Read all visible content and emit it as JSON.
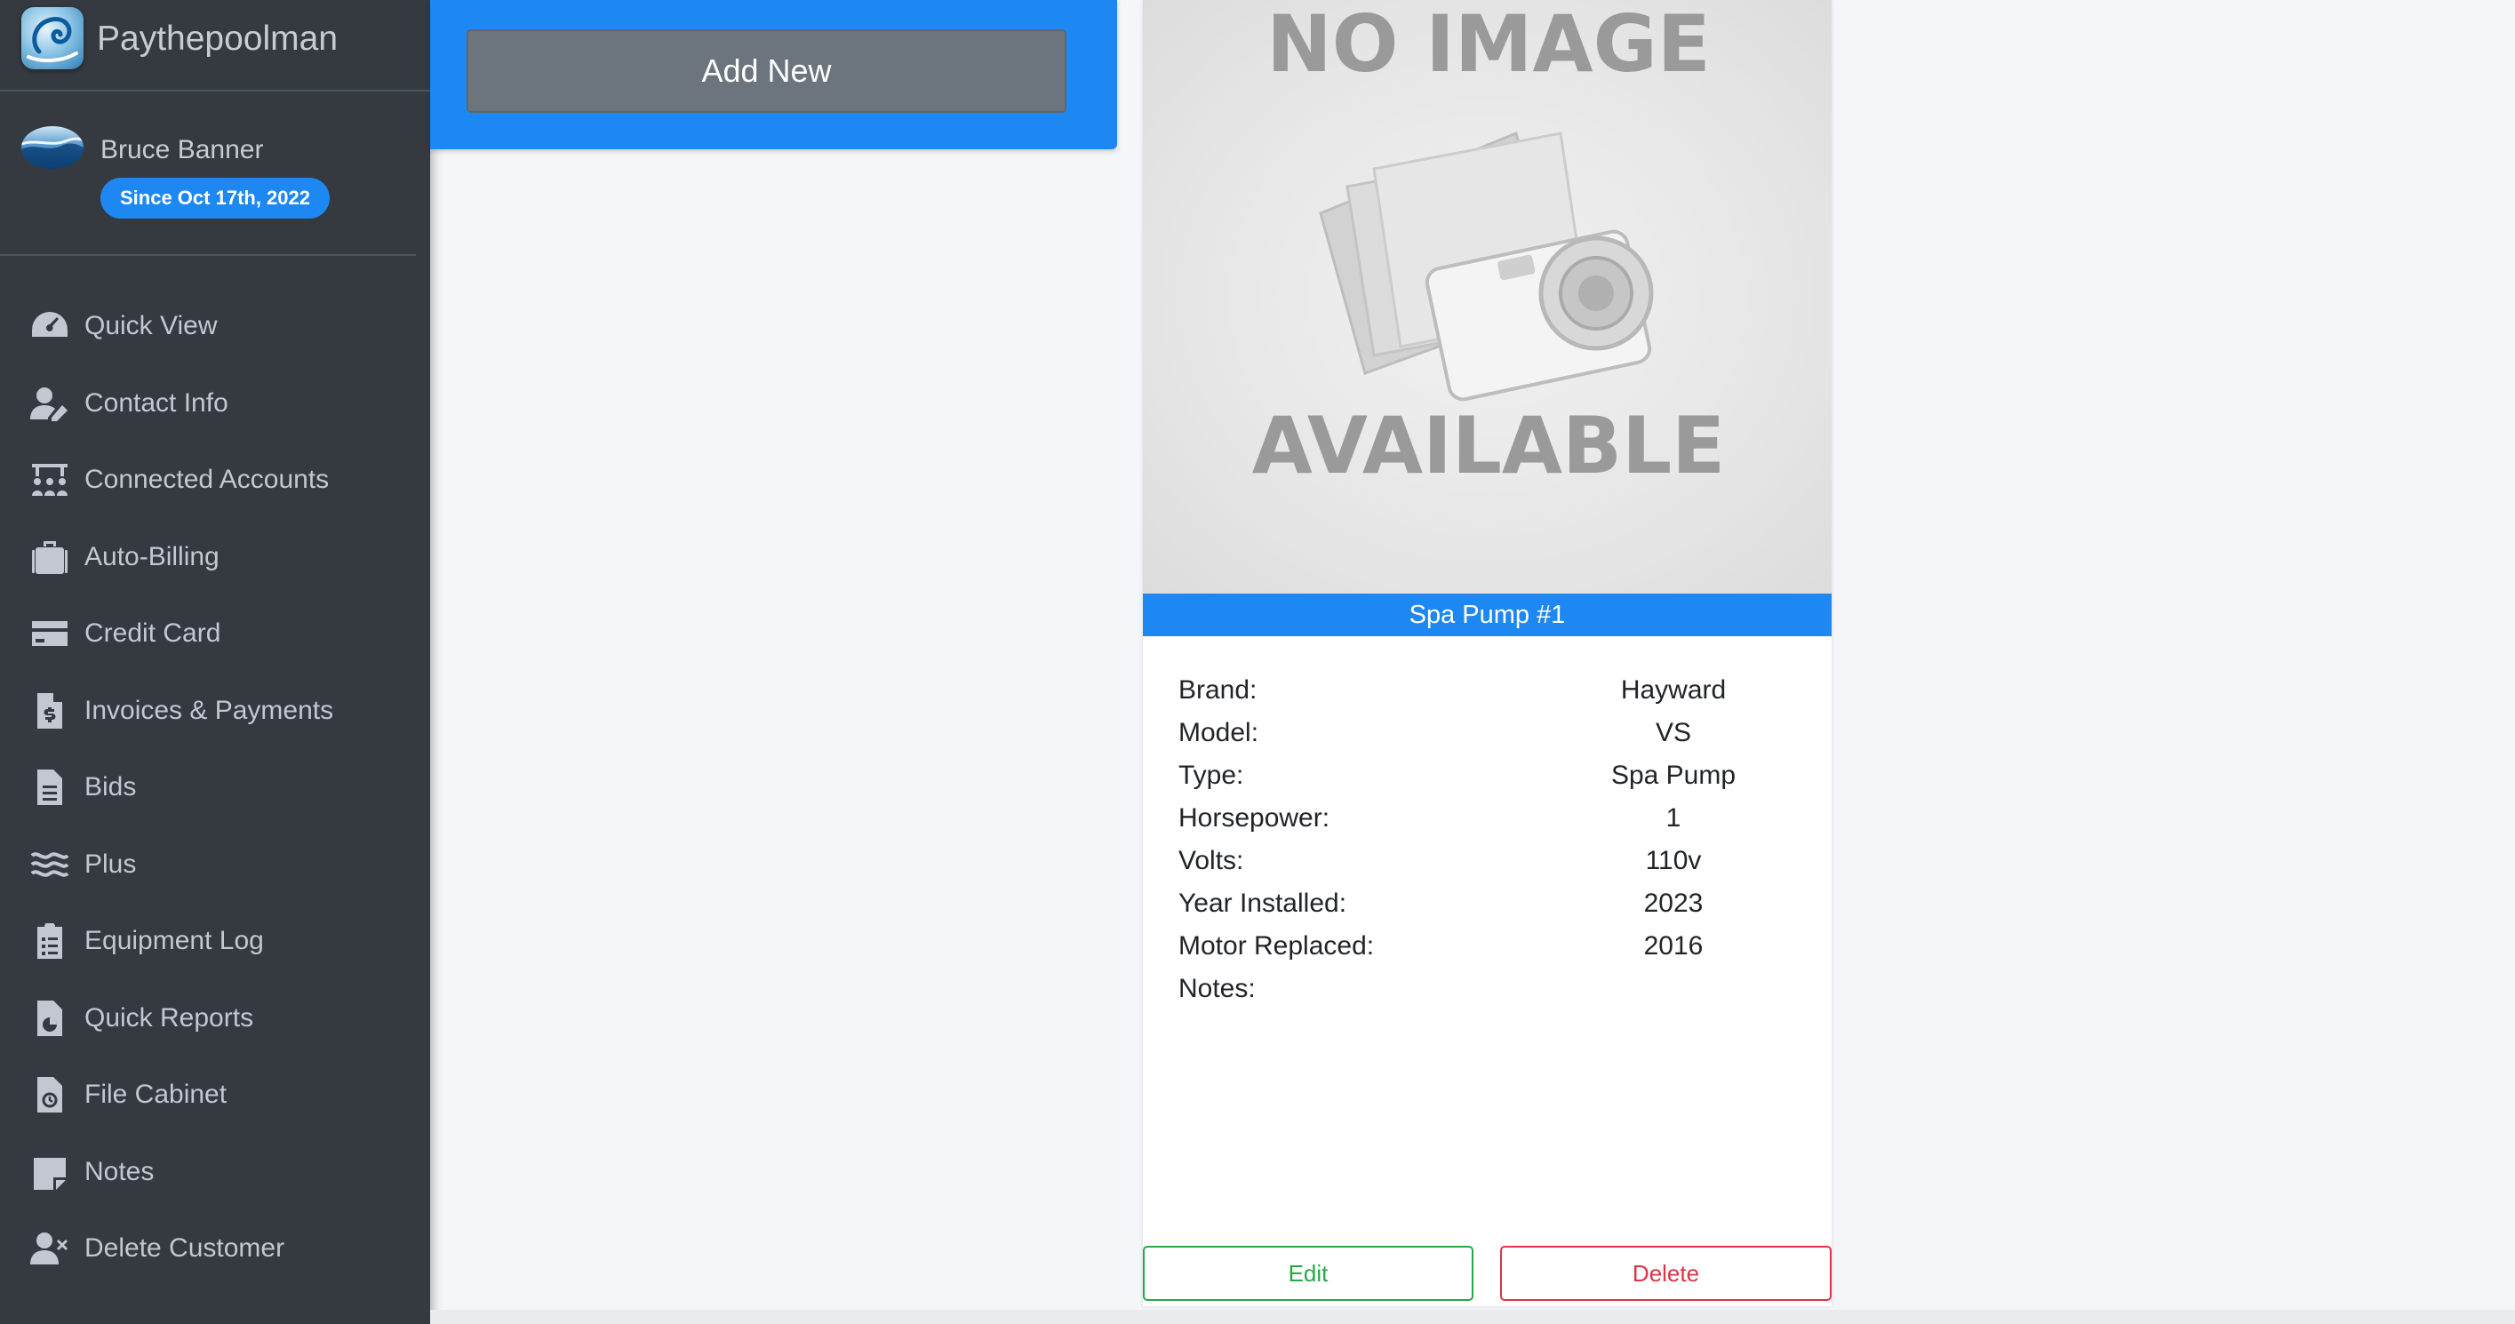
{
  "brand": {
    "name": "Paythepoolman"
  },
  "user": {
    "name": "Bruce Banner",
    "since": "Since Oct 17th, 2022"
  },
  "sidebar": {
    "items": [
      {
        "label": "Quick View",
        "icon": "gauge-icon"
      },
      {
        "label": "Contact Info",
        "icon": "user-edit-icon"
      },
      {
        "label": "Connected Accounts",
        "icon": "users-board-icon"
      },
      {
        "label": "Auto-Billing",
        "icon": "suitcase-icon"
      },
      {
        "label": "Credit Card",
        "icon": "credit-card-icon"
      },
      {
        "label": "Invoices & Payments",
        "icon": "file-invoice-dollar-icon"
      },
      {
        "label": "Bids",
        "icon": "file-alt-icon"
      },
      {
        "label": "Plus",
        "icon": "water-icon"
      },
      {
        "label": "Equipment Log",
        "icon": "clipboard-list-icon"
      },
      {
        "label": "Quick Reports",
        "icon": "file-chart-icon"
      },
      {
        "label": "File Cabinet",
        "icon": "file-cabinet-icon"
      },
      {
        "label": "Notes",
        "icon": "sticky-note-icon"
      },
      {
        "label": "Delete Customer",
        "icon": "user-times-icon"
      }
    ]
  },
  "toolbar": {
    "add_label": "Add New"
  },
  "equipment": {
    "image_text_top": "NO IMAGE",
    "image_text_bottom": "AVAILABLE",
    "title": "Spa Pump #1",
    "specs": [
      {
        "label": "Brand:",
        "value": "Hayward"
      },
      {
        "label": "Model:",
        "value": "VS"
      },
      {
        "label": "Type:",
        "value": "Spa Pump"
      },
      {
        "label": "Horsepower:",
        "value": "1"
      },
      {
        "label": "Volts:",
        "value": "110v"
      },
      {
        "label": "Year Installed:",
        "value": "2023"
      },
      {
        "label": "Motor Replaced:",
        "value": "2016"
      },
      {
        "label": "Notes:",
        "value": ""
      }
    ],
    "edit_label": "Edit",
    "delete_label": "Delete"
  },
  "colors": {
    "sidebar_bg": "#343a40",
    "accent": "#1e88f2",
    "edit": "#28a745",
    "delete": "#dc3545"
  }
}
